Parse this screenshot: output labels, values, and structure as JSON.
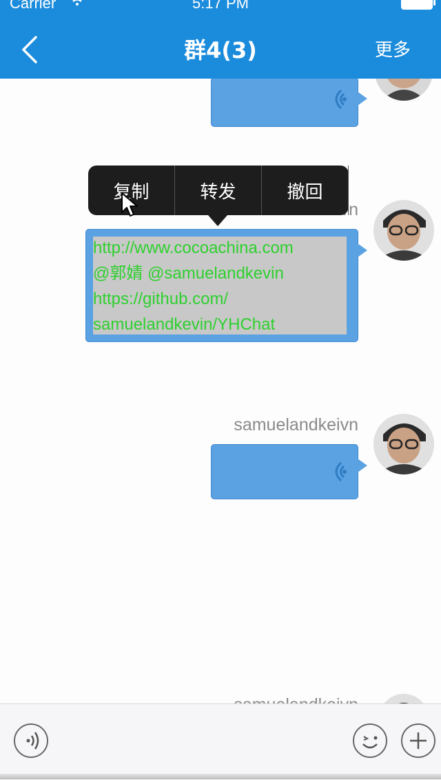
{
  "status_bar": {
    "carrier": "Carrier",
    "time": "5:17 PM"
  },
  "nav": {
    "title": "群4(3)",
    "more_label": "更多"
  },
  "context_menu": {
    "items": [
      "复制",
      "转发",
      "撤回"
    ]
  },
  "messages": [
    {
      "type": "voice"
    },
    {
      "type": "text",
      "sender": "samuelandkeivn",
      "lines": [
        "http://www.cocoachina.com",
        "@郭婧 @samuelandkevin",
        "https://github.com/",
        "samuelandkevin/YHChat"
      ]
    },
    {
      "type": "voice",
      "sender": "samuelandkeivn"
    },
    {
      "type": "partial",
      "sender": "samuelandkeivn"
    }
  ],
  "colors": {
    "nav_bg": "#1b8bdc",
    "bubble": "#5aa2e2",
    "link_text": "#2ed02e"
  }
}
